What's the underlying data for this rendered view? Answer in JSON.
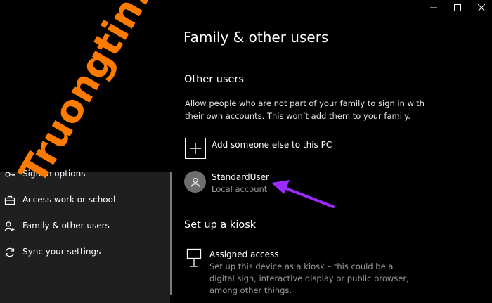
{
  "watermark": "Truongtin.top",
  "window_controls": {
    "minimize": "—",
    "maximize": "☐",
    "close": "✕"
  },
  "sidebar": {
    "items": [
      {
        "label": "Sign-in options",
        "icon": "key-icon"
      },
      {
        "label": "Access work or school",
        "icon": "briefcase-icon"
      },
      {
        "label": "Family & other users",
        "icon": "person-add-icon"
      },
      {
        "label": "Sync your settings",
        "icon": "sync-icon"
      }
    ]
  },
  "main": {
    "title": "Family & other users",
    "other_users": {
      "heading": "Other users",
      "description": "Allow people who are not part of your family to sign in with their own accounts. This won’t add them to your family.",
      "add_label": "Add someone else to this PC",
      "user": {
        "name": "StandardUser",
        "type": "Local account"
      }
    },
    "kiosk": {
      "heading": "Set up a kiosk",
      "assigned_title": "Assigned access",
      "assigned_desc": "Set up this device as a kiosk – this could be a digital sign, interactive display or public browser, among other things."
    }
  },
  "colors": {
    "watermark": "#ff7b00",
    "arrow": "#9b2bff",
    "background": "#000000",
    "sidebar_panel": "#1f1f1f",
    "secondary_text": "#9a9a9a"
  }
}
